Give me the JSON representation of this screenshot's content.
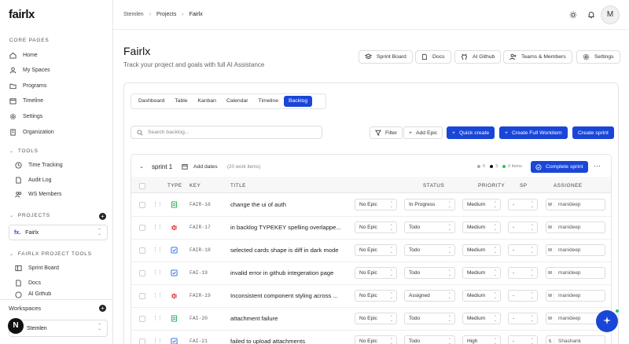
{
  "sidebar": {
    "logo": "fairlx",
    "core_pages_label": "CORE PAGES",
    "core_pages": [
      "Home",
      "My Spaces",
      "Programs",
      "Timeline",
      "Settings",
      "Organization"
    ],
    "tools_label": "TOOLS",
    "tools": [
      "Time Tracking",
      "Audit Log",
      "WS Members"
    ],
    "projects_label": "PROJECTS",
    "project_selected": "Fairlx",
    "project_tools_label": "FAIRLX PROJECT TOOLS",
    "project_tools": [
      "Sprint Board",
      "Docs",
      "AI Github"
    ],
    "workspaces_label": "Workspaces",
    "workspace_selected": "Stemlen",
    "workspace_initial": "N"
  },
  "topbar": {
    "breadcrumb": [
      "Stemlen",
      "Projects",
      "Fairlx"
    ],
    "avatar_initial": "M"
  },
  "header": {
    "title": "Fairlx",
    "subtitle": "Track your project and goals with full AI Assistance",
    "buttons": [
      "Sprint Board",
      "Docs",
      "AI Github",
      "Teams & Members",
      "Settings"
    ]
  },
  "view_tabs": [
    "Dashboard",
    "Table",
    "Kanban",
    "Calendar",
    "Timeline",
    "Backlog"
  ],
  "active_tab": "Backlog",
  "toolbar": {
    "search_placeholder": "Search backlog...",
    "filter": "Filter",
    "add_epic": "Add Epic",
    "quick_create": "Quick create",
    "create_full": "Create Full Workitem",
    "create_sprint": "Create sprint"
  },
  "sprint": {
    "name": "sprint 1",
    "add_dates": "Add dates",
    "count": "(20 work items)",
    "stat1": "6",
    "stat2": "3",
    "stat3": "0 items",
    "complete": "Complete sprint",
    "more": "···"
  },
  "columns": [
    "TYPE",
    "KEY",
    "TITLE",
    "STATUS",
    "PRIORITY",
    "SP",
    "ASSIGNEE"
  ],
  "colors": {
    "accent": "#1a46d8",
    "task": "#2563eb",
    "story": "#16a34a",
    "bug": "#dc2626"
  },
  "rows": [
    {
      "type": "story-icon",
      "key": "FAIR-16",
      "title": "change the ui of auth",
      "epic": "No Epic",
      "status": "In Progress",
      "priority": "Medium",
      "sp": "-",
      "assignee_initial": "M",
      "assignee": "manideep"
    },
    {
      "type": "bug-icon",
      "key": "FAIR-17",
      "title": "in backlog TYPEKEY spelling overlappe...",
      "epic": "No Epic",
      "status": "Todo",
      "priority": "Medium",
      "sp": "-",
      "assignee_initial": "M",
      "assignee": "manideep"
    },
    {
      "type": "task-icon",
      "key": "FAIR-18",
      "title": "selected cards shape is diff in dark mode",
      "epic": "No Epic",
      "status": "Todo",
      "priority": "Medium",
      "sp": "-",
      "assignee_initial": "M",
      "assignee": "manideep"
    },
    {
      "type": "task-icon",
      "key": "FAI-19",
      "title": "invalid error in github integeration page",
      "epic": "No Epic",
      "status": "Todo",
      "priority": "Medium",
      "sp": "-",
      "assignee_initial": "M",
      "assignee": "manideep"
    },
    {
      "type": "bug-icon",
      "key": "FAIR-19",
      "title": "Inconsistent component styling across ...",
      "epic": "No Epic",
      "status": "Assigned",
      "priority": "Medium",
      "sp": "-",
      "assignee_initial": "M",
      "assignee": "manideep"
    },
    {
      "type": "story-icon",
      "key": "FAI-20",
      "title": "attachment failure",
      "epic": "No Epic",
      "status": "Todo",
      "priority": "Medium",
      "sp": "-",
      "assignee_initial": "M",
      "assignee": "manideep"
    },
    {
      "type": "task-icon",
      "key": "FAI-21",
      "title": "failed to upload attachments",
      "epic": "No Epic",
      "status": "Todo",
      "priority": "High",
      "sp": "-",
      "assignee_initial": "S",
      "assignee": "Shashank"
    }
  ]
}
